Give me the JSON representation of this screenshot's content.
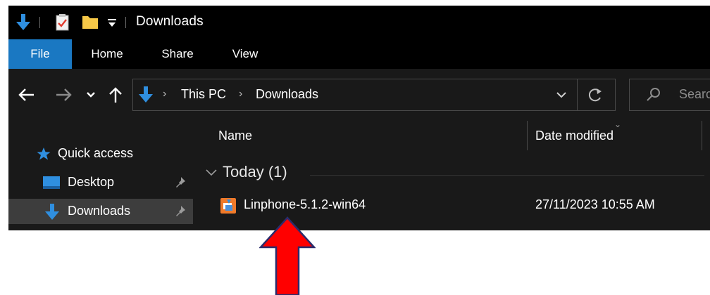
{
  "window": {
    "title": "Downloads"
  },
  "ribbon": {
    "tabs": [
      "File",
      "Home",
      "Share",
      "View"
    ],
    "active_tab": "File"
  },
  "address": {
    "crumbs": [
      "This PC",
      "Downloads"
    ]
  },
  "search": {
    "placeholder": "Searc"
  },
  "nav_pane": {
    "items": [
      {
        "label": "Quick access",
        "icon": "star-icon",
        "pinned": false
      },
      {
        "label": "Desktop",
        "icon": "desktop-folder-icon",
        "pinned": true
      },
      {
        "label": "Downloads",
        "icon": "downloads-arrow-icon",
        "pinned": true,
        "selected": true
      }
    ]
  },
  "content": {
    "columns": {
      "name": "Name",
      "date": "Date modified"
    },
    "group": {
      "title": "Today (1)"
    },
    "files": [
      {
        "name": "Linphone-5.1.2-win64",
        "date_modified": "27/11/2023 10:55 AM",
        "icon": "installer-icon"
      }
    ]
  },
  "colors": {
    "accent": "#1a78c2",
    "annotation_arrow": "#ff0000",
    "annotation_arrow_border": "#2b2b6b"
  }
}
